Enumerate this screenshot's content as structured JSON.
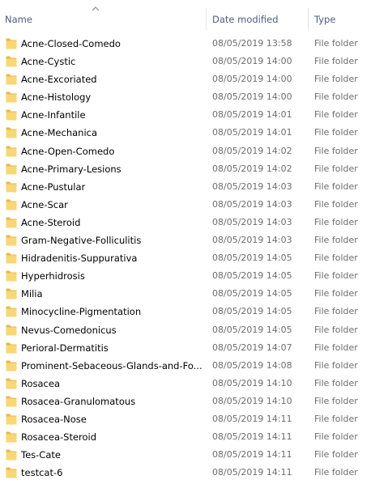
{
  "columns": {
    "name": "Name",
    "date_modified": "Date modified",
    "type": "Type"
  },
  "sort_indicator": "chevron-up-icon",
  "folder_color": "#f8d775",
  "items": [
    {
      "name": "Acne-Closed-Comedo",
      "date": "08/05/2019 13:58",
      "type": "File folder"
    },
    {
      "name": "Acne-Cystic",
      "date": "08/05/2019 14:00",
      "type": "File folder"
    },
    {
      "name": "Acne-Excoriated",
      "date": "08/05/2019 14:00",
      "type": "File folder"
    },
    {
      "name": "Acne-Histology",
      "date": "08/05/2019 14:00",
      "type": "File folder"
    },
    {
      "name": "Acne-Infantile",
      "date": "08/05/2019 14:01",
      "type": "File folder"
    },
    {
      "name": "Acne-Mechanica",
      "date": "08/05/2019 14:01",
      "type": "File folder"
    },
    {
      "name": "Acne-Open-Comedo",
      "date": "08/05/2019 14:02",
      "type": "File folder"
    },
    {
      "name": "Acne-Primary-Lesions",
      "date": "08/05/2019 14:02",
      "type": "File folder"
    },
    {
      "name": "Acne-Pustular",
      "date": "08/05/2019 14:03",
      "type": "File folder"
    },
    {
      "name": "Acne-Scar",
      "date": "08/05/2019 14:03",
      "type": "File folder"
    },
    {
      "name": "Acne-Steroid",
      "date": "08/05/2019 14:03",
      "type": "File folder"
    },
    {
      "name": "Gram-Negative-Folliculitis",
      "date": "08/05/2019 14:03",
      "type": "File folder"
    },
    {
      "name": "Hidradenitis-Suppurativa",
      "date": "08/05/2019 14:05",
      "type": "File folder"
    },
    {
      "name": "Hyperhidrosis",
      "date": "08/05/2019 14:05",
      "type": "File folder"
    },
    {
      "name": "Milia",
      "date": "08/05/2019 14:05",
      "type": "File folder"
    },
    {
      "name": "Minocycline-Pigmentation",
      "date": "08/05/2019 14:05",
      "type": "File folder"
    },
    {
      "name": "Nevus-Comedonicus",
      "date": "08/05/2019 14:05",
      "type": "File folder"
    },
    {
      "name": "Perioral-Dermatitis",
      "date": "08/05/2019 14:07",
      "type": "File folder"
    },
    {
      "name": "Prominent-Sebaceous-Glands-and-Fo...",
      "date": "08/05/2019 14:08",
      "type": "File folder"
    },
    {
      "name": "Rosacea",
      "date": "08/05/2019 14:10",
      "type": "File folder"
    },
    {
      "name": "Rosacea-Granulomatous",
      "date": "08/05/2019 14:10",
      "type": "File folder"
    },
    {
      "name": "Rosacea-Nose",
      "date": "08/05/2019 14:11",
      "type": "File folder"
    },
    {
      "name": "Rosacea-Steroid",
      "date": "08/05/2019 14:11",
      "type": "File folder"
    },
    {
      "name": "Tes-Cate",
      "date": "08/05/2019 14:11",
      "type": "File folder"
    },
    {
      "name": "testcat-6",
      "date": "08/05/2019 14:11",
      "type": "File folder"
    }
  ]
}
